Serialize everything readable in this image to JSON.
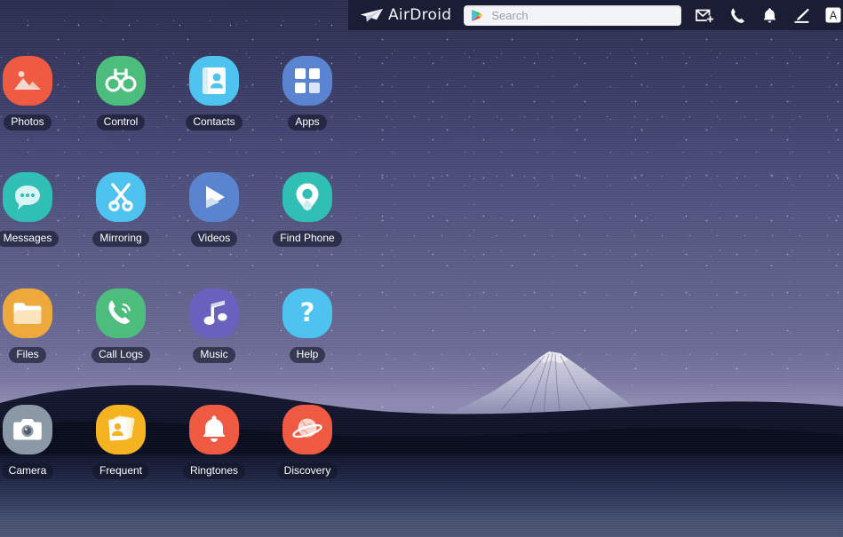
{
  "app": {
    "name": "AirDroid",
    "window_title": "AirDroid"
  },
  "topbar": {
    "logo_text": "AirDroid",
    "logo_icon": "paper-plane-icon",
    "search": {
      "placeholder": "Search",
      "value": "",
      "leading_icon": "google-play-icon"
    },
    "icons": [
      {
        "name": "new-message-icon",
        "label": "New Message"
      },
      {
        "name": "phone-icon",
        "label": "Call"
      },
      {
        "name": "bell-icon",
        "label": "Notifications"
      },
      {
        "name": "edit-pencil-icon",
        "label": "Edit"
      },
      {
        "name": "letter-a-icon",
        "label": "A"
      }
    ]
  },
  "desktop": {
    "wallpaper_description": "Mount Fuji at night under a starry purple sky",
    "colors": {
      "sky_top": "#2b2d4f",
      "sky_bottom": "#8d89b2",
      "water": "#44506f",
      "topbar": "#1a1c34"
    },
    "apps": [
      {
        "label": "Photos",
        "icon": "photos-icon",
        "color": "#ef5b42"
      },
      {
        "label": "Control",
        "icon": "binoculars-icon",
        "color": "#4cbd7c"
      },
      {
        "label": "Contacts",
        "icon": "contacts-icon",
        "color": "#4ec3f0"
      },
      {
        "label": "Apps",
        "icon": "apps-grid-icon",
        "color": "#5b84d0"
      },
      {
        "label": "Messages",
        "icon": "message-icon",
        "color": "#2fbfb5"
      },
      {
        "label": "Mirroring",
        "icon": "scissors-icon",
        "color": "#4ec3f0"
      },
      {
        "label": "Videos",
        "icon": "play-icon",
        "color": "#5b84d0"
      },
      {
        "label": "Find Phone",
        "icon": "location-pin-icon",
        "color": "#2fbfb5"
      },
      {
        "label": "Files",
        "icon": "folder-icon",
        "color": "#eda93c"
      },
      {
        "label": "Call Logs",
        "icon": "phone-call-icon",
        "color": "#4cbd7c"
      },
      {
        "label": "Music",
        "icon": "music-note-icon",
        "color": "#6a61bf"
      },
      {
        "label": "Help",
        "icon": "question-mark-icon",
        "color": "#4ec3f0"
      },
      {
        "label": "Camera",
        "icon": "camera-icon",
        "color": "#8b99a6"
      },
      {
        "label": "Frequent",
        "icon": "frequent-contacts-icon",
        "color": "#f5b321"
      },
      {
        "label": "Ringtones",
        "icon": "bell-ringtone-icon",
        "color": "#ef5b42"
      },
      {
        "label": "Discovery",
        "icon": "planet-icon",
        "color": "#ef5b42"
      }
    ]
  }
}
